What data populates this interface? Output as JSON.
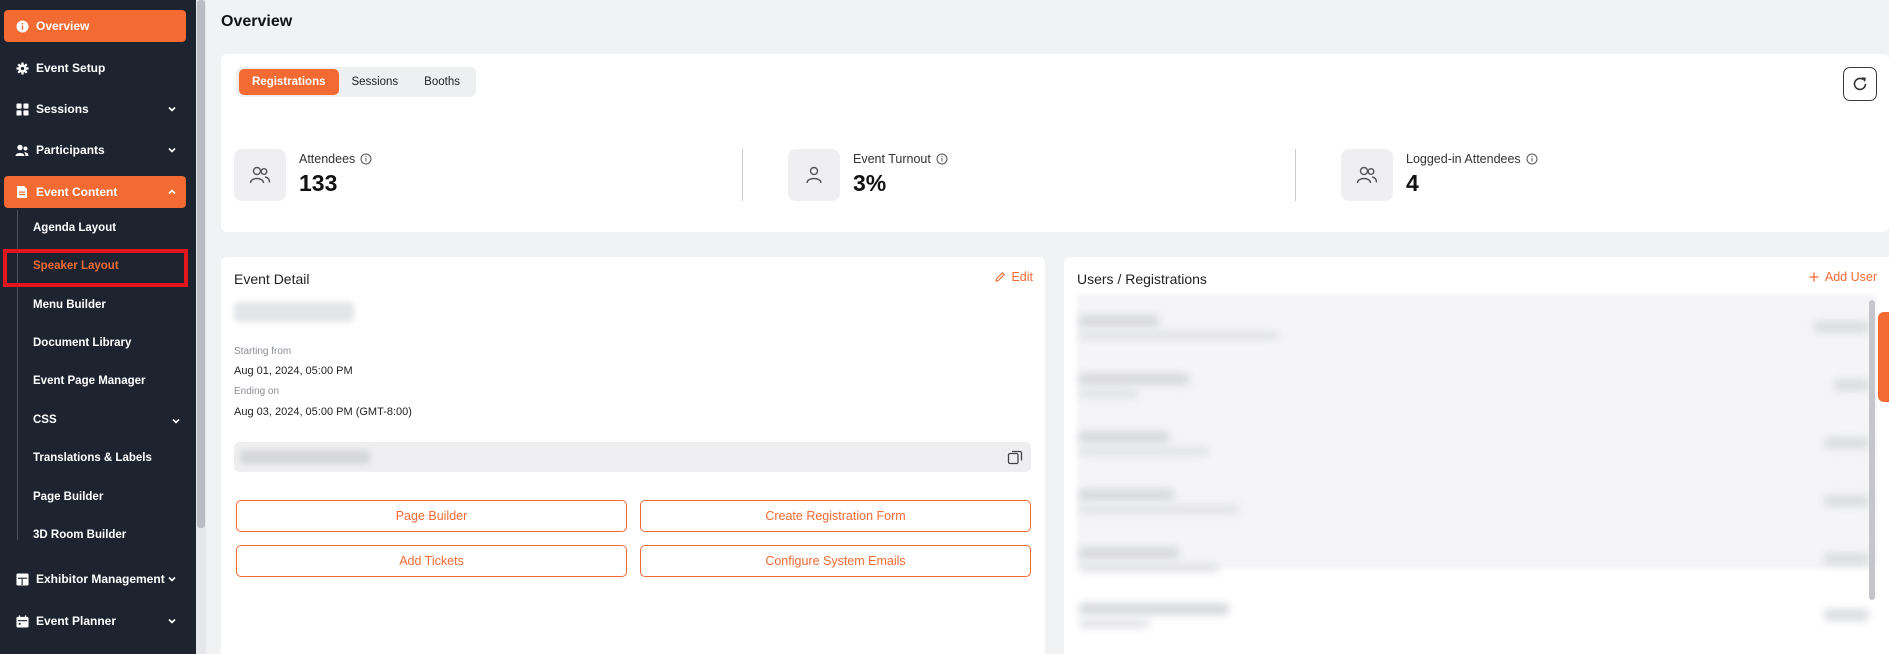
{
  "sidebar": {
    "items": [
      {
        "label": "Overview",
        "icon": "info-icon"
      },
      {
        "label": "Event Setup",
        "icon": "gear-icon"
      },
      {
        "label": "Sessions",
        "icon": "grid-icon"
      },
      {
        "label": "Participants",
        "icon": "users-icon"
      },
      {
        "label": "Event Content",
        "icon": "document-icon"
      },
      {
        "label": "Exhibitor Management",
        "icon": "layout-icon"
      },
      {
        "label": "Event Planner",
        "icon": "calendar-icon"
      }
    ],
    "sub_items": [
      "Agenda Layout",
      "Speaker Layout",
      "Menu Builder",
      "Document Library",
      "Event Page Manager",
      "CSS",
      "Translations & Labels",
      "Page Builder",
      "3D Room Builder"
    ]
  },
  "page": {
    "title": "Overview"
  },
  "tabs": [
    "Registrations",
    "Sessions",
    "Booths"
  ],
  "stats": [
    {
      "label": "Attendees",
      "value": "133"
    },
    {
      "label": "Event Turnout",
      "value": "3%"
    },
    {
      "label": "Logged-in Attendees",
      "value": "4"
    }
  ],
  "event_detail": {
    "title": "Event Detail",
    "edit_label": "Edit",
    "starting_label": "Starting from",
    "starting_value": "Aug 01, 2024, 05:00 PM",
    "ending_label": "Ending on",
    "ending_value": "Aug 03, 2024, 05:00 PM (GMT-8:00)",
    "buttons": [
      "Page Builder",
      "Create Registration Form",
      "Add Tickets",
      "Configure System Emails"
    ]
  },
  "users": {
    "title": "Users / Registrations",
    "add_label": "Add User"
  },
  "colors": {
    "accent": "#f36a32",
    "sidebar": "#1e2330",
    "highlight": "#e3161b"
  }
}
